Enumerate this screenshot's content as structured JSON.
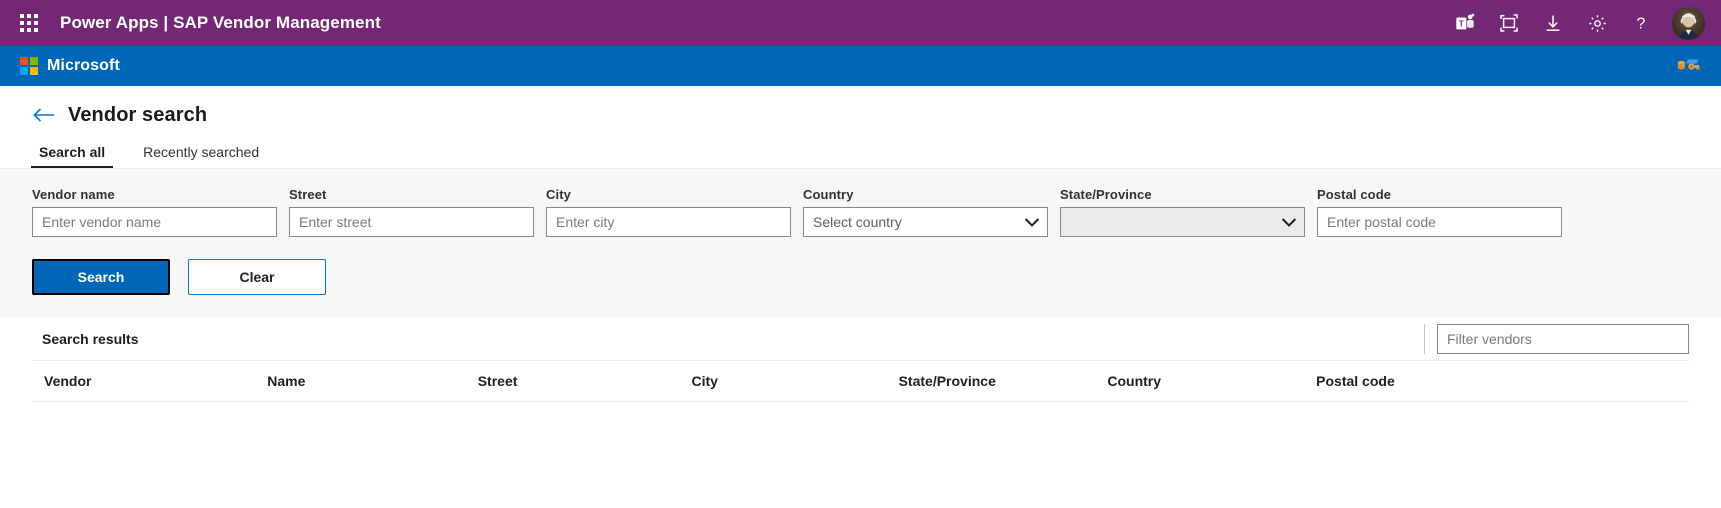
{
  "powerbar": {
    "waffle_label": "app-launcher",
    "app_name": "Power Apps",
    "separator": "|",
    "context_name": "SAP Vendor Management",
    "title": "Power Apps  |  SAP Vendor Management",
    "background": "#742774",
    "icons": [
      {
        "name": "teams-icon",
        "tooltip": "Teams"
      },
      {
        "name": "fullscreen-icon",
        "tooltip": "Full screen"
      },
      {
        "name": "download-icon",
        "tooltip": "Download"
      },
      {
        "name": "gear-icon",
        "tooltip": "Settings"
      },
      {
        "name": "help-icon",
        "tooltip": "Help",
        "glyph": "?"
      }
    ],
    "avatar_name": "user-avatar"
  },
  "msbar": {
    "brand": "Microsoft",
    "background": "#0067b8",
    "right_icon": "data-app-icon"
  },
  "page": {
    "back_label": "←",
    "title": "Vendor search"
  },
  "tabs": [
    {
      "label": "Search all",
      "active": true
    },
    {
      "label": "Recently searched",
      "active": false
    }
  ],
  "search_form": {
    "fields": [
      {
        "label": "Vendor name",
        "placeholder": "Enter vendor name",
        "type": "text",
        "value": "",
        "name": "vendor-name"
      },
      {
        "label": "Street",
        "placeholder": "Enter street",
        "type": "text",
        "value": "",
        "name": "street"
      },
      {
        "label": "City",
        "placeholder": "Enter city",
        "type": "text",
        "value": "",
        "name": "city"
      },
      {
        "label": "Country",
        "placeholder": "Select country",
        "type": "select",
        "value": "",
        "disabled": false,
        "name": "country"
      },
      {
        "label": "State/Province",
        "placeholder": "",
        "type": "select",
        "value": "",
        "disabled": true,
        "name": "state-province"
      },
      {
        "label": "Postal code",
        "placeholder": "Enter postal code",
        "type": "text",
        "value": "",
        "name": "postal-code"
      }
    ],
    "search_button": "Search",
    "clear_button": "Clear"
  },
  "results": {
    "title": "Search results",
    "filter_placeholder": "Filter vendors",
    "filter_value": "",
    "columns": [
      "Vendor",
      "Name",
      "Street",
      "City",
      "State/Province",
      "Country",
      "Postal code"
    ],
    "rows": []
  },
  "colors": {
    "powerbar_purple": "#742774",
    "ms_blue": "#0067b8",
    "accent_blue": "#0078d4",
    "panel_grey": "#f7f7f7",
    "disabled_grey": "#edebe9"
  }
}
